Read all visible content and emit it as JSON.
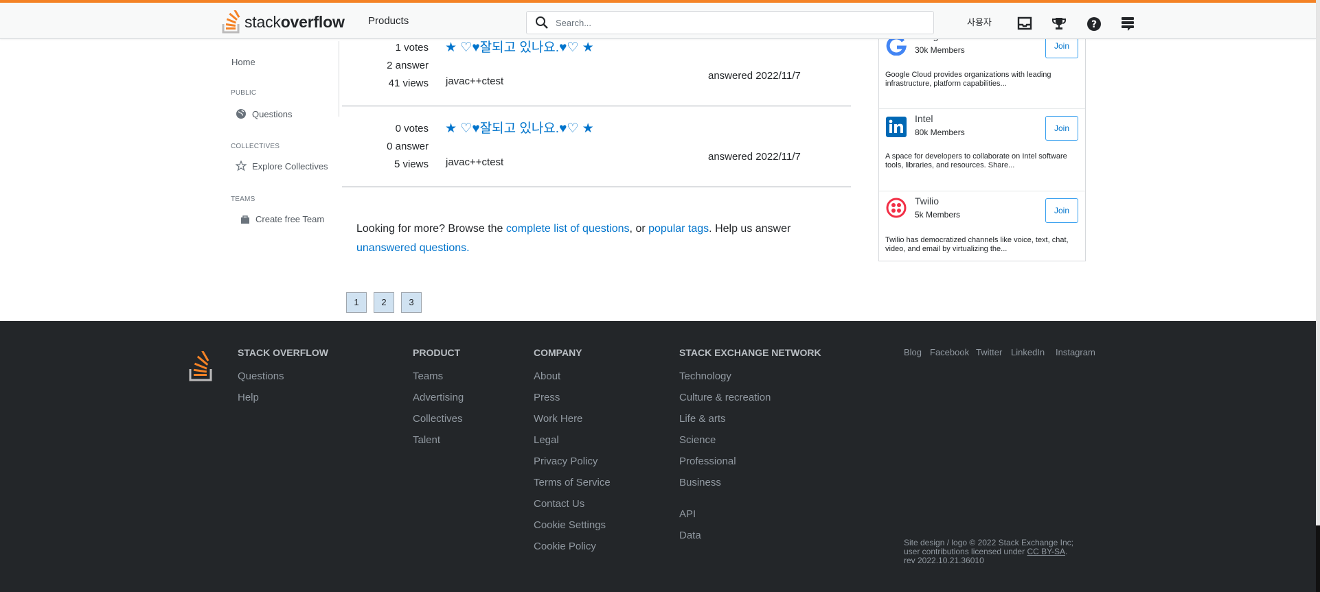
{
  "header": {
    "logo_text_light": "stack",
    "logo_text_bold": "overflow",
    "products": "Products",
    "search_placeholder": "Search...",
    "user": "사용자",
    "icons": [
      "inbox-icon",
      "trophy-icon",
      "help-icon",
      "site-switcher-icon"
    ],
    "accent": "#f48225"
  },
  "sidebar": {
    "home": "Home",
    "public": "PUBLIC",
    "questions": "Questions",
    "collectives_head": "COLLECTIVES",
    "explore": "Explore Collectives",
    "teams_head": "TEAMS",
    "create_team": "Create free Team"
  },
  "questions": [
    {
      "votes": "1 votes",
      "answers": "2 answer",
      "views": "41 views",
      "title": "★ ♡♥잘되고 있나요.♥♡ ★",
      "tag": "javac++ctest",
      "answered": "answered 2022/11/7"
    },
    {
      "votes": "0 votes",
      "answers": "0 answer",
      "views": "5 views",
      "title": "★ ♡♥잘되고 있나요.♥♡ ★",
      "tag": "javac++ctest",
      "answered": "answered 2022/11/7"
    }
  ],
  "more": {
    "pre": "Looking for more? Browse the ",
    "link1": "complete list of questions",
    "mid1": ", or ",
    "link2": "popular tags",
    "mid2": ". Help us answer ",
    "link3": "unanswered questions."
  },
  "pagination": [
    "1",
    "2",
    "3"
  ],
  "collectives": [
    {
      "name": "Google Cloud",
      "members": "30k Members",
      "join": "Join",
      "desc": "Google Cloud provides organizations with leading infrastructure, platform capabilities...",
      "color": "#4285f4"
    },
    {
      "name": "Intel",
      "members": "80k Members",
      "join": "Join",
      "desc": "A space for developers to collaborate on Intel software tools, libraries, and resources. Share...",
      "color": "#0068b5"
    },
    {
      "name": "Twilio",
      "members": "5k Members",
      "join": "Join",
      "desc": "Twilio has democratized channels like voice, text, chat, video, and email by virtualizing the...",
      "color": "#f22f46"
    }
  ],
  "footer": {
    "stack_overflow": {
      "heading": "STACK OVERFLOW",
      "links": [
        "Questions",
        "Help"
      ]
    },
    "product": {
      "heading": "PRODUCT",
      "links": [
        "Teams",
        "Advertising",
        "Collectives",
        "Talent"
      ]
    },
    "company": {
      "heading": "COMPANY",
      "links": [
        "About",
        "Press",
        "Work Here",
        "Legal",
        "Privacy Policy",
        "Terms of Service",
        "Contact Us",
        "Cookie Settings",
        "Cookie Policy"
      ]
    },
    "network": {
      "heading": "STACK EXCHANGE NETWORK",
      "links": [
        "Technology",
        "Culture & recreation",
        "Life & arts",
        "Science",
        "Professional",
        "Business"
      ],
      "links2": [
        "API",
        "Data"
      ]
    },
    "social": [
      "Blog",
      "Facebook",
      "Twitter",
      "LinkedIn",
      "Instagram"
    ],
    "copyright_pre": "Site design / logo © 2022 Stack Exchange Inc; user contributions licensed under ",
    "license": "CC BY-SA",
    "copyright_post": ".",
    "rev": "rev 2022.10.21.36010",
    "background": "#232629"
  }
}
